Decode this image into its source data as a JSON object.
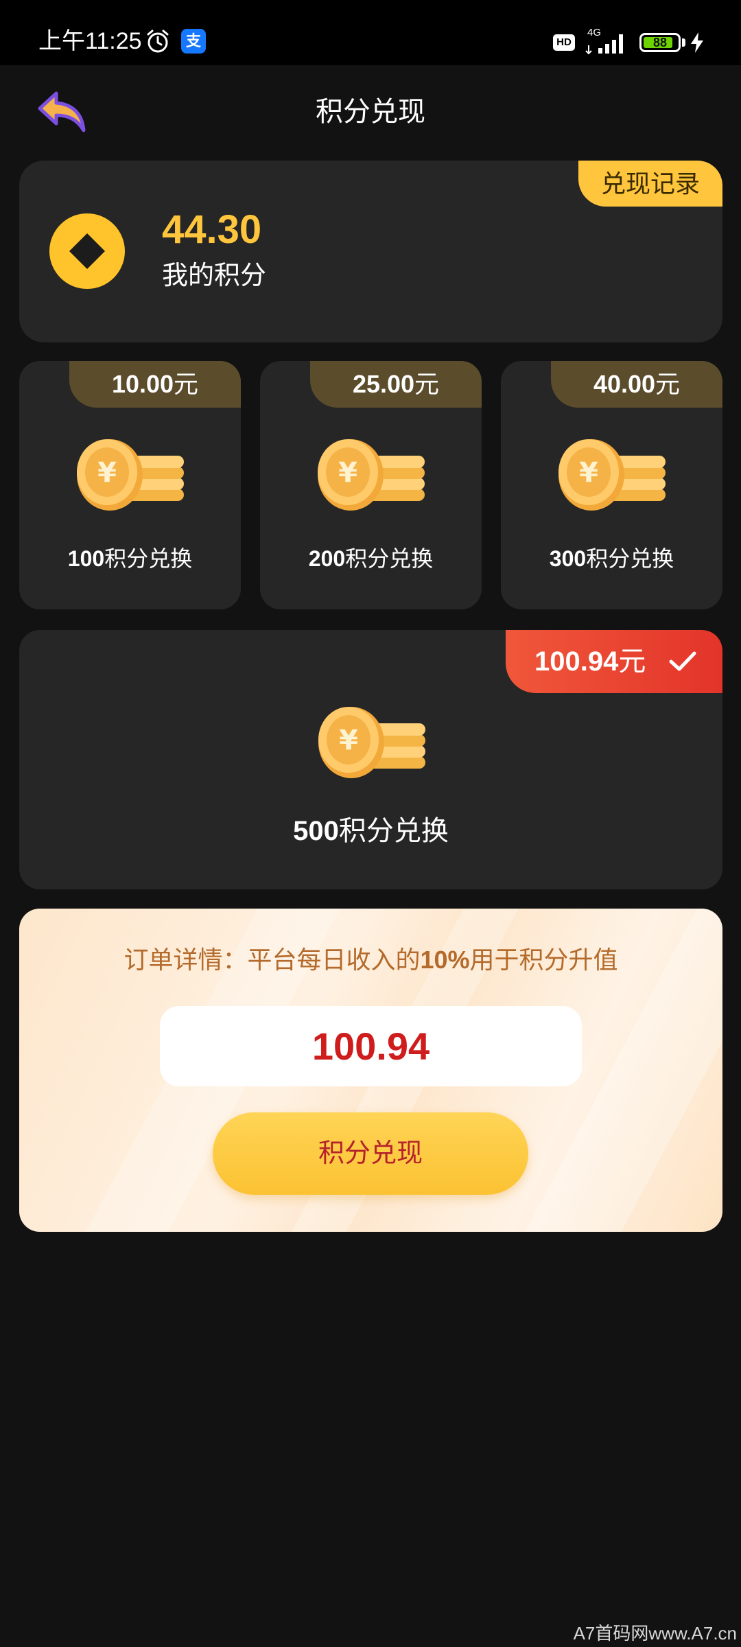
{
  "status_bar": {
    "time": "上午11:25",
    "alipay_glyph": "支",
    "hd_label": "HD",
    "network_label": "4G",
    "battery_level": 88,
    "battery_text": "88"
  },
  "header": {
    "title": "积分兑现",
    "back_icon": "back-arrow-icon"
  },
  "points_card": {
    "record_tab": "兑现记录",
    "value": "44.30",
    "label": "我的积分"
  },
  "options": [
    {
      "price": "10.00",
      "unit": "元",
      "points": "100",
      "label_suffix": "积分兑换",
      "selected": false
    },
    {
      "price": "25.00",
      "unit": "元",
      "points": "200",
      "label_suffix": "积分兑换",
      "selected": false
    },
    {
      "price": "40.00",
      "unit": "元",
      "points": "300",
      "label_suffix": "积分兑换",
      "selected": false
    },
    {
      "price": "100.94",
      "unit": "元",
      "points": "500",
      "label_suffix": "积分兑换",
      "selected": true
    }
  ],
  "order": {
    "desc_prefix": "订单详情：平台每日收入的",
    "desc_pct": "10%",
    "desc_suffix": "用于积分升值",
    "amount": "100.94",
    "submit_label": "积分兑现"
  },
  "colors": {
    "accent_gold": "#ffc53d",
    "price_tab_brown": "#5b4c2c",
    "selected_red": "#e3342a",
    "amount_red": "#cf1d1d"
  },
  "watermark": "A7首码网www.A7.cn"
}
